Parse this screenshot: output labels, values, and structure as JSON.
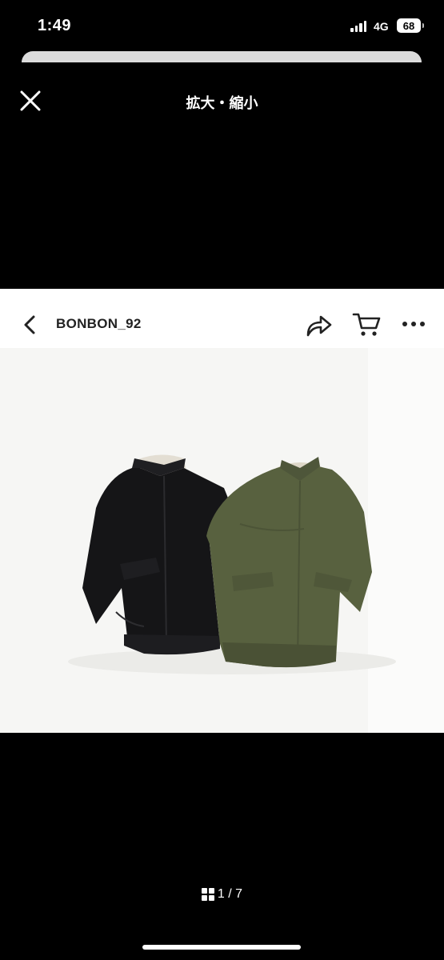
{
  "status_bar": {
    "time": "1:49",
    "network": "4G",
    "battery": "68"
  },
  "viewer": {
    "title": "拡大・縮小",
    "close_icon": "close-icon"
  },
  "page": {
    "shop_name": "BONBON_92",
    "icons": [
      "back-chevron-icon",
      "share-icon",
      "cart-icon",
      "more-icon"
    ],
    "product_image": "black and olive green jackets"
  },
  "pager": {
    "label": "1 / 7",
    "icon": "grid-icon"
  },
  "colors": {
    "background": "#000000",
    "page": "#ffffff",
    "jacket_black": "#151517",
    "jacket_olive": "#58613f"
  }
}
